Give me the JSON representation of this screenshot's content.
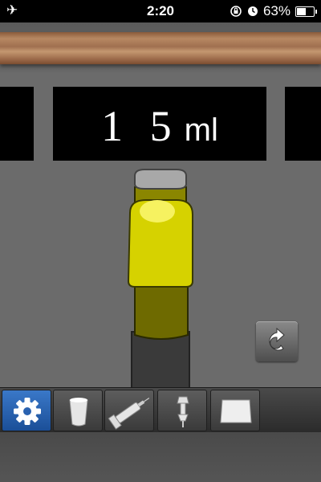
{
  "status_bar": {
    "time": "2:20",
    "battery": "63%",
    "battery_level": 0.63,
    "icons": [
      "airplane-icon",
      "rotation-lock-icon",
      "alarm-icon",
      "battery-icon"
    ]
  },
  "display": {
    "volume_value": "1 5",
    "volume_unit": "ml"
  },
  "vial": {
    "cap_color": "#a8a8a8",
    "body_color": "#d6d200",
    "liquid_color": "#6e6a00",
    "base_color": "#3a3a3a"
  },
  "toolbar": {
    "tools": [
      {
        "icon": "gear-icon",
        "active": true
      },
      {
        "icon": "cup-icon",
        "active": false
      },
      {
        "icon": "syringe-icon",
        "active": false
      },
      {
        "icon": "dropper-icon",
        "active": false
      },
      {
        "icon": "tray-icon",
        "active": false
      }
    ]
  },
  "reset_button": {
    "icon": "rotate-icon"
  }
}
